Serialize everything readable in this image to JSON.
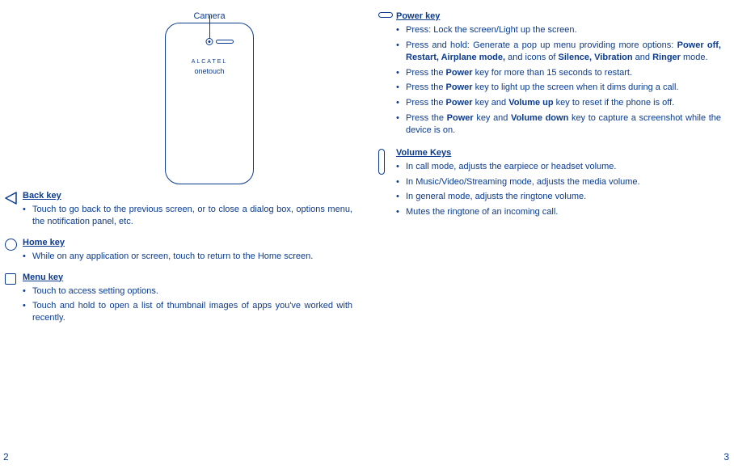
{
  "camera_label": "Camera",
  "brand_line1": "ALCATEL",
  "brand_line2": "onetouch",
  "left": {
    "page_number": "2",
    "sections": [
      {
        "heading": "Back key",
        "bullets": [
          "Touch to go back to the previous screen, or to close a dialog box, options menu, the notification panel, etc."
        ]
      },
      {
        "heading": "Home key",
        "bullets": [
          "While on any application or screen, touch to return to the Home screen."
        ]
      },
      {
        "heading": "Menu key",
        "bullets": [
          "Touch to access setting options.",
          "Touch and hold to open a list of thumbnail images of apps you've worked with recently."
        ]
      }
    ]
  },
  "right": {
    "page_number": "3",
    "sections": [
      {
        "heading": "Power key",
        "bullets_html": [
          "Press: Lock the screen/Light up the screen.",
          "Press and hold: Generate a pop up menu providing more options: <b>Power off, Restart, Airplane mode,</b> and icons of <b>Silence, Vibration</b> and <b>Ringer</b> mode.",
          "Press the <b>Power</b> key for more than 15 seconds to restart.",
          "Press the <b>Power</b> key to light up the screen when it dims during a call.",
          "Press the <b>Power</b> key and <b>Volume up</b> key to reset if the phone is off.",
          "Press the <b>Power</b> key and <b>Volume down</b> key to capture a screenshot while the device is on."
        ]
      },
      {
        "heading": "Volume Keys ",
        "bullets": [
          "In call mode,  adjusts the earpiece or headset volume.",
          "In Music/Video/Streaming mode, adjusts the media volume.",
          "In general mode, adjusts the ringtone volume.",
          "Mutes the ringtone of an incoming call."
        ]
      }
    ]
  }
}
